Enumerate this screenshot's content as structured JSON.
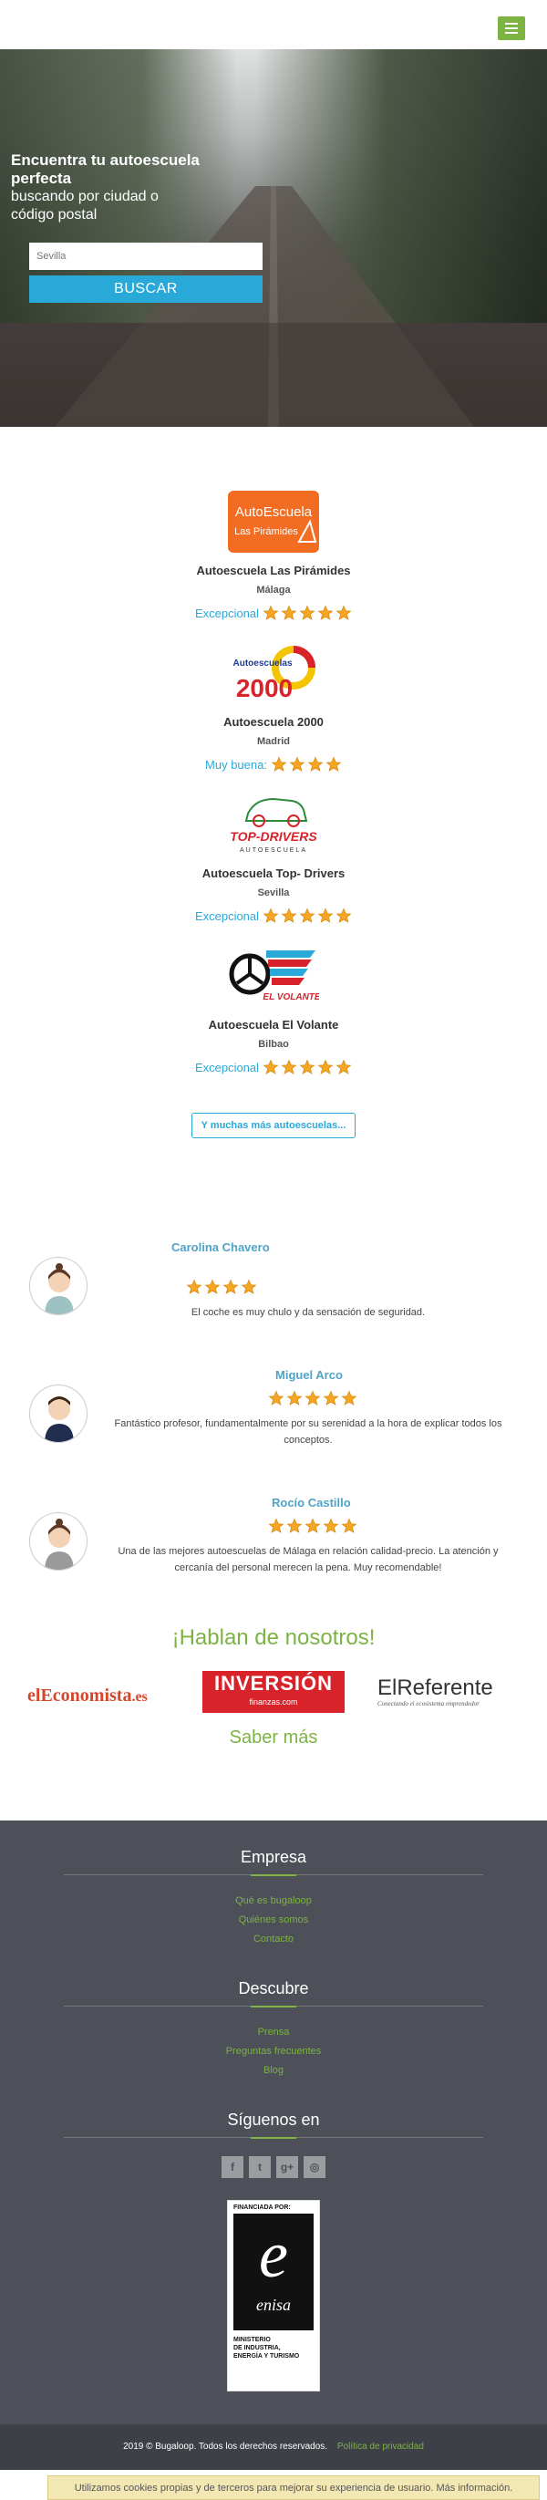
{
  "header": {
    "menu_icon": "hamburger-icon",
    "accent": "#7cb342"
  },
  "hero": {
    "headline_bold": "Encuentra tu autoescuela perfecta",
    "headline_line2": "buscando por ciudad o",
    "headline_line3": "código postal",
    "search_placeholder": "Sevilla",
    "search_button": "BUSCAR"
  },
  "schools": [
    {
      "name": "Autoescuela Las Pirámides",
      "city": "Málaga",
      "rating_label": "Excepcional",
      "stars": 5,
      "logo_line1": "AutoEscuela",
      "logo_line2": "Las Pirámides"
    },
    {
      "name": "Autoescuela 2000",
      "city": "Madrid",
      "rating_label": "Muy buena:",
      "stars": 4,
      "logo_line1": "Autoescuelas",
      "logo_line2": "2000"
    },
    {
      "name": "Autoescuela Top- Drivers",
      "city": "Sevilla",
      "rating_label": "Excepcional",
      "stars": 5,
      "logo_line1": "TOP-DRIVERS",
      "logo_line2": "AUTOESCUELA"
    },
    {
      "name": "Autoescuela El Volante",
      "city": "Bilbao",
      "rating_label": "Excepcional",
      "stars": 5,
      "logo_line1": "EL VOLANTE",
      "logo_line2": ""
    }
  ],
  "more_button": "Y muchas más autoescuelas...",
  "reviews": [
    {
      "name": "Carolina Chavero",
      "stars": 4,
      "text": "El coche es muy chulo y da sensación de seguridad.",
      "avatar": "female-avatar"
    },
    {
      "name": "Miguel Arco",
      "stars": 5,
      "text": "Fantástico profesor, fundamentalmente por su serenidad a la hora de explicar todos los conceptos.",
      "avatar": "male-avatar"
    },
    {
      "name": "Rocío Castillo",
      "stars": 5,
      "text": "Una de las mejores autoescuelas de Málaga en relación calidad-precio. La atención y cercanía del personal merecen la pena. Muy recomendable!",
      "avatar": "female-avatar"
    }
  ],
  "press": {
    "title": "¡Hablan de nosotros!",
    "logo1_a": "el",
    "logo1_b": "Economista",
    "logo1_c": ".es",
    "logo2_main": "INVERSIÓN",
    "logo2_sub": "finanzas.com",
    "logo3_main": "ElReferente",
    "logo3_sub": "Conectando el ecosistema emprendedor",
    "saber_mas": "Saber más"
  },
  "footer": {
    "empresa_title": "Empresa",
    "empresa_links": [
      "Qué es bugaloop",
      "Quiénes somos",
      "Contacto"
    ],
    "descubre_title": "Descubre",
    "descubre_links": [
      "Prensa",
      "Preguntas frecuentes",
      "Blog"
    ],
    "siguenos_title": "Síguenos en",
    "social": [
      {
        "name": "facebook-icon",
        "glyph": "f"
      },
      {
        "name": "twitter-icon",
        "glyph": "t"
      },
      {
        "name": "google-plus-icon",
        "glyph": "g+"
      },
      {
        "name": "instagram-icon",
        "glyph": "◎"
      }
    ],
    "enisa_top": "FINANCIADA POR:",
    "enisa_name": "enisa",
    "enisa_bottom1": "MINISTERIO",
    "enisa_bottom2": "DE INDUSTRIA,",
    "enisa_bottom3": "ENERGÍA Y TURISMO"
  },
  "copyright": {
    "text": "2019 © Bugaloop. Todos los derechos reservados.",
    "policy": "Política de privacidad"
  },
  "cookie": {
    "text": "Utilizamos cookies propias y de terceros para mejorar su experiencia de usuario. Más información."
  }
}
